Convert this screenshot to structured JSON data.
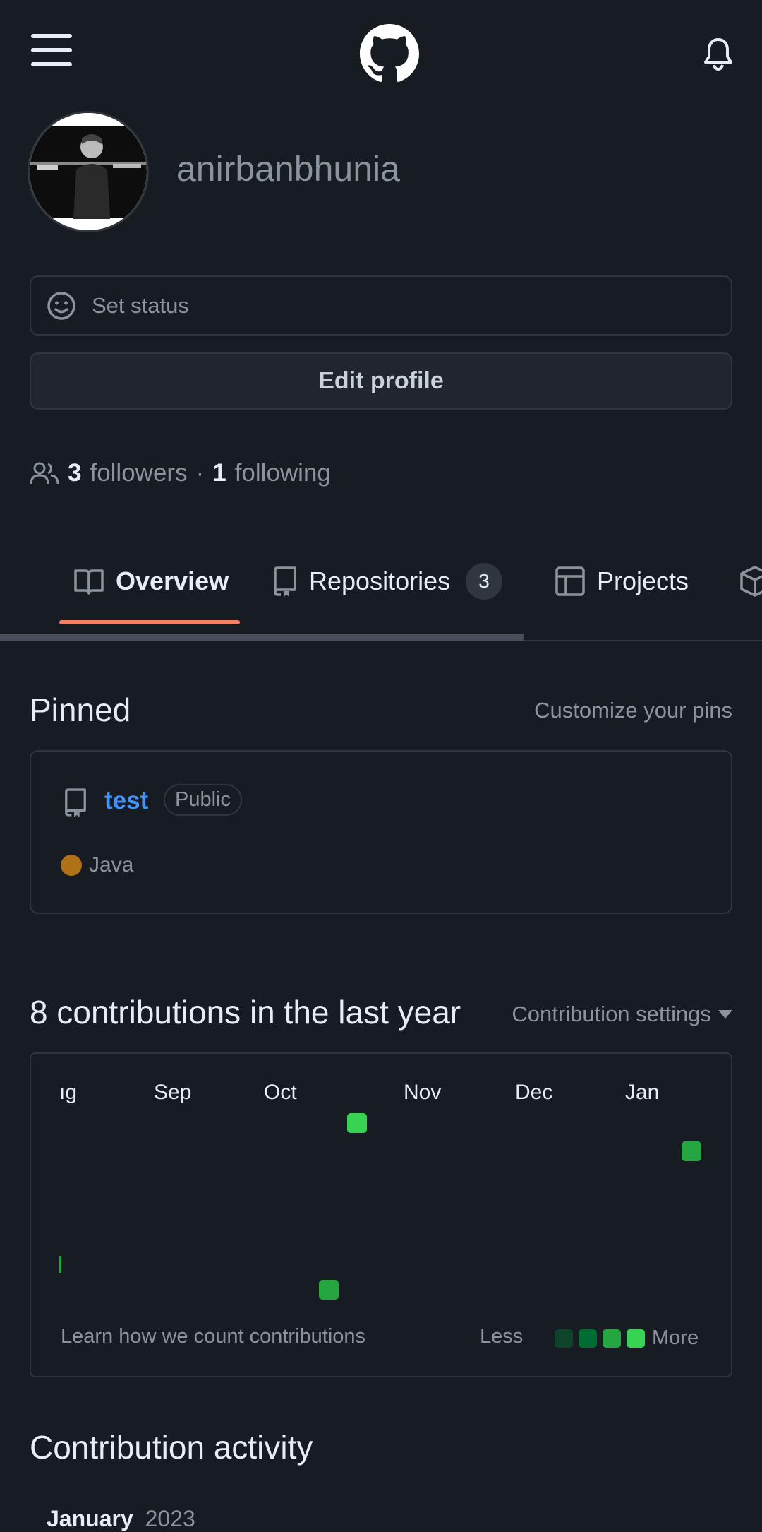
{
  "header": {
    "menu_icon": "hamburger-icon",
    "logo_icon": "github-logo-icon",
    "bell_icon": "bell-icon"
  },
  "profile": {
    "username": "anirbanbhunia",
    "status_placeholder": "Set status",
    "edit_label": "Edit profile",
    "followers_count": "3",
    "followers_label": "followers",
    "separator": "·",
    "following_count": "1",
    "following_label": "following"
  },
  "tabs": [
    {
      "label": "Overview",
      "icon": "book-icon",
      "active": true
    },
    {
      "label": "Repositories",
      "icon": "repo-icon",
      "counter": "3"
    },
    {
      "label": "Projects",
      "icon": "table-icon"
    },
    {
      "label": "",
      "icon": "package-icon"
    }
  ],
  "pinned": {
    "title": "Pinned",
    "customize": "Customize your pins",
    "repo": {
      "name": "test",
      "visibility": "Public",
      "language": "Java",
      "language_color": "#b07219"
    }
  },
  "contributions": {
    "title": "8 contributions in the last year",
    "settings": "Contribution settings",
    "months": [
      "ıg",
      "Sep",
      "Oct",
      "Nov",
      "Dec",
      "Jan"
    ],
    "learn": "Learn how we count contributions",
    "less": "Less",
    "more": "More",
    "legend_colors": [
      "#0e4429",
      "#006d32",
      "#26a641",
      "#39d353"
    ]
  },
  "activity": {
    "title": "Contribution activity",
    "month": "January",
    "year": "2023"
  }
}
